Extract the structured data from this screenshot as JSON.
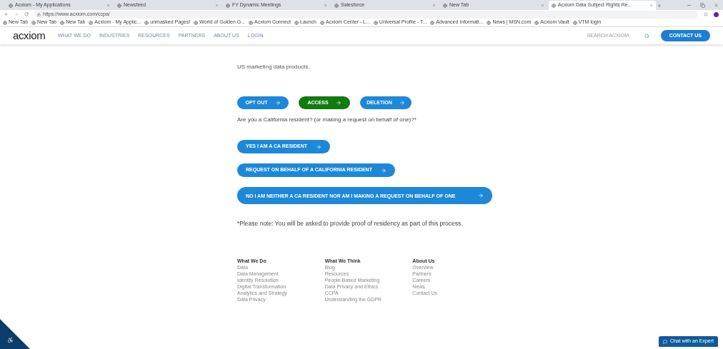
{
  "browser": {
    "tabs": [
      {
        "title": "Acxiom - My Applications",
        "selected": false
      },
      {
        "title": "Newsfeed",
        "selected": false
      },
      {
        "title": "FY Dynamic Meetings",
        "selected": false
      },
      {
        "title": "Salesforce",
        "selected": false
      },
      {
        "title": "New Tab",
        "selected": false
      },
      {
        "title": "Acxiom Data Subject Rights Re...",
        "selected": true
      }
    ],
    "url": "https://www.acxiom.com/ccpa/",
    "bookmarks": [
      "New Tab",
      "New Tab",
      "New Tab",
      "Acxiom - My Applic...",
      "unmasked Pages!",
      "World of Golden G...",
      "Acxiom Connect",
      "Launch",
      "Acxiom Center - L...",
      "Universal Profile - T...",
      "Advanced Informati...",
      "News | MSN.com",
      "Acxiom Vault",
      "VTM login"
    ]
  },
  "site": {
    "logo": "acxiom",
    "nav": [
      "WHAT WE DO",
      "INDUSTRIES",
      "RESOURCES",
      "PARTNERS",
      "ABOUT US",
      "LOGIN"
    ],
    "search": {
      "placeholder": "SEARCH ACXIOM"
    },
    "contact_button": "CONTACT US"
  },
  "page": {
    "intro_text": "US marketing data products.",
    "request_types": [
      {
        "label": "OPT OUT",
        "selected": false
      },
      {
        "label": "ACCESS",
        "selected": true
      },
      {
        "label": "DELETION",
        "selected": false
      }
    ],
    "question": "Are you a California resident? (or making a request on behalf of one)?*",
    "residency_options": [
      "YES I AM A CA RESIDENT",
      "REQUEST ON BEHALF OF A CALIFORNIA RESIDENT",
      "NO I AM NEITHER A CA RESIDENT NOR AM I MAKING A REQUEST ON BEHALF OF ONE"
    ],
    "note": "*Please note: You will be asked to provide proof of residency as part of this process."
  },
  "footer": {
    "columns": [
      {
        "heading": "What We Do",
        "links": [
          "Data",
          "Data Management",
          "Identity Resolution",
          "Digital Transformation",
          "Analytics and Strategy",
          "Data Privacy"
        ]
      },
      {
        "heading": "What We Think",
        "links": [
          "Blog",
          "Resources",
          "People-Based Marketing",
          "Data Privacy and Ethics",
          "CCPA",
          "Understanding the GDPR"
        ]
      },
      {
        "heading": "About Us",
        "links": [
          "Overview",
          "Partners",
          "Careers",
          "News",
          "Contact Us"
        ]
      }
    ]
  },
  "chat_button": "Chat with an Expert"
}
